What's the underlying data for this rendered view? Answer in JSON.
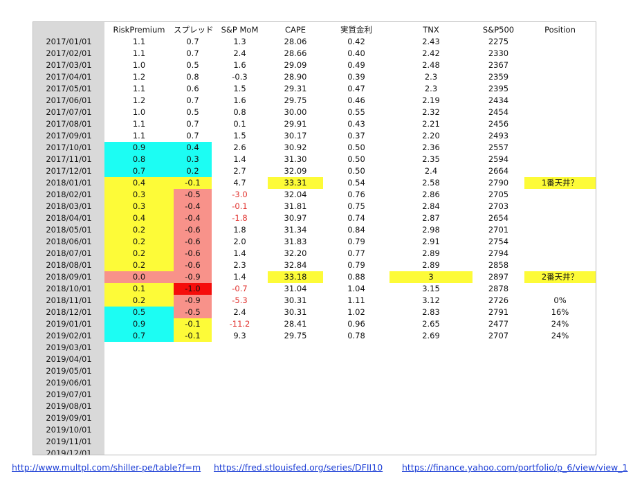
{
  "headers": [
    "RiskPremium",
    "スプレッド",
    "S&P MoM",
    "CAPE",
    "実質金利",
    "TNX",
    "S&P500",
    "Position"
  ],
  "colors": {
    "cyan": "#1cfdf3",
    "yellow": "#fdfb38",
    "salmon": "#f8928a",
    "red": "#f50d0b",
    "negative_text": "#e1312d",
    "row_header_gray": "#d9d9d9"
  },
  "rows": [
    {
      "date": "2017/01/01",
      "risk": "1.1",
      "spread": "0.7",
      "mom": "1.3",
      "cape": "28.06",
      "real": "0.42",
      "tnx": "2.43",
      "sp": "2275",
      "pos": "",
      "rc": "",
      "sc": "",
      "mc": "",
      "cc": "",
      "tc": "",
      "pc": ""
    },
    {
      "date": "2017/02/01",
      "risk": "1.1",
      "spread": "0.7",
      "mom": "2.4",
      "cape": "28.66",
      "real": "0.40",
      "tnx": "2.42",
      "sp": "2330",
      "pos": "",
      "rc": "",
      "sc": "",
      "mc": "",
      "cc": "",
      "tc": "",
      "pc": ""
    },
    {
      "date": "2017/03/01",
      "risk": "1.0",
      "spread": "0.5",
      "mom": "1.6",
      "cape": "29.09",
      "real": "0.49",
      "tnx": "2.48",
      "sp": "2367",
      "pos": "",
      "rc": "",
      "sc": "",
      "mc": "",
      "cc": "",
      "tc": "",
      "pc": ""
    },
    {
      "date": "2017/04/01",
      "risk": "1.2",
      "spread": "0.8",
      "mom": "-0.3",
      "cape": "28.90",
      "real": "0.39",
      "tnx": "2.3",
      "sp": "2359",
      "pos": "",
      "rc": "",
      "sc": "",
      "mc": "",
      "cc": "",
      "tc": "",
      "pc": ""
    },
    {
      "date": "2017/05/01",
      "risk": "1.1",
      "spread": "0.6",
      "mom": "1.5",
      "cape": "29.31",
      "real": "0.47",
      "tnx": "2.3",
      "sp": "2395",
      "pos": "",
      "rc": "",
      "sc": "",
      "mc": "",
      "cc": "",
      "tc": "",
      "pc": ""
    },
    {
      "date": "2017/06/01",
      "risk": "1.2",
      "spread": "0.7",
      "mom": "1.6",
      "cape": "29.75",
      "real": "0.46",
      "tnx": "2.19",
      "sp": "2434",
      "pos": "",
      "rc": "",
      "sc": "",
      "mc": "",
      "cc": "",
      "tc": "",
      "pc": ""
    },
    {
      "date": "2017/07/01",
      "risk": "1.0",
      "spread": "0.5",
      "mom": "0.8",
      "cape": "30.00",
      "real": "0.55",
      "tnx": "2.32",
      "sp": "2454",
      "pos": "",
      "rc": "",
      "sc": "",
      "mc": "",
      "cc": "",
      "tc": "",
      "pc": ""
    },
    {
      "date": "2017/08/01",
      "risk": "1.1",
      "spread": "0.7",
      "mom": "0.1",
      "cape": "29.91",
      "real": "0.43",
      "tnx": "2.21",
      "sp": "2456",
      "pos": "",
      "rc": "",
      "sc": "",
      "mc": "",
      "cc": "",
      "tc": "",
      "pc": ""
    },
    {
      "date": "2017/09/01",
      "risk": "1.1",
      "spread": "0.7",
      "mom": "1.5",
      "cape": "30.17",
      "real": "0.37",
      "tnx": "2.20",
      "sp": "2493",
      "pos": "",
      "rc": "",
      "sc": "",
      "mc": "",
      "cc": "",
      "tc": "",
      "pc": ""
    },
    {
      "date": "2017/10/01",
      "risk": "0.9",
      "spread": "0.4",
      "mom": "2.6",
      "cape": "30.92",
      "real": "0.50",
      "tnx": "2.36",
      "sp": "2557",
      "pos": "",
      "rc": "cyan",
      "sc": "cyan",
      "mc": "",
      "cc": "",
      "tc": "",
      "pc": ""
    },
    {
      "date": "2017/11/01",
      "risk": "0.8",
      "spread": "0.3",
      "mom": "1.4",
      "cape": "31.30",
      "real": "0.50",
      "tnx": "2.35",
      "sp": "2594",
      "pos": "",
      "rc": "cyan",
      "sc": "cyan",
      "mc": "",
      "cc": "",
      "tc": "",
      "pc": ""
    },
    {
      "date": "2017/12/01",
      "risk": "0.7",
      "spread": "0.2",
      "mom": "2.7",
      "cape": "32.09",
      "real": "0.50",
      "tnx": "2.4",
      "sp": "2664",
      "pos": "",
      "rc": "cyan",
      "sc": "cyan",
      "mc": "",
      "cc": "",
      "tc": "",
      "pc": ""
    },
    {
      "date": "2018/01/01",
      "risk": "0.4",
      "spread": "-0.1",
      "mom": "4.7",
      "cape": "33.31",
      "real": "0.54",
      "tnx": "2.58",
      "sp": "2790",
      "pos": "1番天井？",
      "rc": "yellow",
      "sc": "yellow",
      "mc": "",
      "cc": "yellow",
      "tc": "",
      "pc": "yellow"
    },
    {
      "date": "2018/02/01",
      "risk": "0.3",
      "spread": "-0.5",
      "mom": "-3.0",
      "cape": "32.04",
      "real": "0.76",
      "tnx": "2.86",
      "sp": "2705",
      "pos": "",
      "rc": "yellow",
      "sc": "salmon",
      "mc": "neg",
      "cc": "",
      "tc": "",
      "pc": ""
    },
    {
      "date": "2018/03/01",
      "risk": "0.3",
      "spread": "-0.4",
      "mom": "-0.1",
      "cape": "31.81",
      "real": "0.75",
      "tnx": "2.84",
      "sp": "2703",
      "pos": "",
      "rc": "yellow",
      "sc": "salmon",
      "mc": "neg",
      "cc": "",
      "tc": "",
      "pc": ""
    },
    {
      "date": "2018/04/01",
      "risk": "0.4",
      "spread": "-0.4",
      "mom": "-1.8",
      "cape": "30.97",
      "real": "0.74",
      "tnx": "2.87",
      "sp": "2654",
      "pos": "",
      "rc": "yellow",
      "sc": "salmon",
      "mc": "neg",
      "cc": "",
      "tc": "",
      "pc": ""
    },
    {
      "date": "2018/05/01",
      "risk": "0.2",
      "spread": "-0.6",
      "mom": "1.8",
      "cape": "31.34",
      "real": "0.84",
      "tnx": "2.98",
      "sp": "2701",
      "pos": "",
      "rc": "yellow",
      "sc": "salmon",
      "mc": "",
      "cc": "",
      "tc": "",
      "pc": ""
    },
    {
      "date": "2018/06/01",
      "risk": "0.2",
      "spread": "-0.6",
      "mom": "2.0",
      "cape": "31.83",
      "real": "0.79",
      "tnx": "2.91",
      "sp": "2754",
      "pos": "",
      "rc": "yellow",
      "sc": "salmon",
      "mc": "",
      "cc": "",
      "tc": "",
      "pc": ""
    },
    {
      "date": "2018/07/01",
      "risk": "0.2",
      "spread": "-0.6",
      "mom": "1.4",
      "cape": "32.20",
      "real": "0.77",
      "tnx": "2.89",
      "sp": "2794",
      "pos": "",
      "rc": "yellow",
      "sc": "salmon",
      "mc": "",
      "cc": "",
      "tc": "",
      "pc": ""
    },
    {
      "date": "2018/08/01",
      "risk": "0.2",
      "spread": "-0.6",
      "mom": "2.3",
      "cape": "32.84",
      "real": "0.79",
      "tnx": "2.89",
      "sp": "2858",
      "pos": "",
      "rc": "yellow",
      "sc": "salmon",
      "mc": "",
      "cc": "",
      "tc": "",
      "pc": ""
    },
    {
      "date": "2018/09/01",
      "risk": "0.0",
      "spread": "-0.9",
      "mom": "1.4",
      "cape": "33.18",
      "real": "0.88",
      "tnx": "3",
      "sp": "2897",
      "pos": "2番天井？",
      "rc": "salmon",
      "sc": "salmon",
      "mc": "",
      "cc": "yellow",
      "tc": "yellow",
      "pc": "yellow"
    },
    {
      "date": "2018/10/01",
      "risk": "0.1",
      "spread": "-1.0",
      "mom": "-0.7",
      "cape": "31.04",
      "real": "1.04",
      "tnx": "3.15",
      "sp": "2878",
      "pos": "",
      "rc": "yellow",
      "sc": "red",
      "mc": "neg",
      "cc": "",
      "tc": "",
      "pc": ""
    },
    {
      "date": "2018/11/01",
      "risk": "0.2",
      "spread": "-0.9",
      "mom": "-5.3",
      "cape": "30.31",
      "real": "1.11",
      "tnx": "3.12",
      "sp": "2726",
      "pos": "0%",
      "rc": "yellow",
      "sc": "salmon",
      "mc": "neg",
      "cc": "",
      "tc": "",
      "pc": ""
    },
    {
      "date": "2018/12/01",
      "risk": "0.5",
      "spread": "-0.5",
      "mom": "2.4",
      "cape": "30.31",
      "real": "1.02",
      "tnx": "2.83",
      "sp": "2791",
      "pos": "16%",
      "rc": "cyan",
      "sc": "salmon",
      "mc": "",
      "cc": "",
      "tc": "",
      "pc": ""
    },
    {
      "date": "2019/01/01",
      "risk": "0.9",
      "spread": "-0.1",
      "mom": "-11.2",
      "cape": "28.41",
      "real": "0.96",
      "tnx": "2.65",
      "sp": "2477",
      "pos": "24%",
      "rc": "cyan",
      "sc": "yellow",
      "mc": "neg",
      "cc": "",
      "tc": "",
      "pc": ""
    },
    {
      "date": "2019/02/01",
      "risk": "0.7",
      "spread": "-0.1",
      "mom": "9.3",
      "cape": "29.75",
      "real": "0.78",
      "tnx": "2.69",
      "sp": "2707",
      "pos": "24%",
      "rc": "cyan",
      "sc": "yellow",
      "mc": "",
      "cc": "",
      "tc": "",
      "pc": ""
    },
    {
      "date": "2019/03/01",
      "risk": "",
      "spread": "",
      "mom": "",
      "cape": "",
      "real": "",
      "tnx": "",
      "sp": "",
      "pos": "",
      "rc": "",
      "sc": "",
      "mc": "",
      "cc": "",
      "tc": "",
      "pc": ""
    },
    {
      "date": "2019/04/01",
      "risk": "",
      "spread": "",
      "mom": "",
      "cape": "",
      "real": "",
      "tnx": "",
      "sp": "",
      "pos": "",
      "rc": "",
      "sc": "",
      "mc": "",
      "cc": "",
      "tc": "",
      "pc": ""
    },
    {
      "date": "2019/05/01",
      "risk": "",
      "spread": "",
      "mom": "",
      "cape": "",
      "real": "",
      "tnx": "",
      "sp": "",
      "pos": "",
      "rc": "",
      "sc": "",
      "mc": "",
      "cc": "",
      "tc": "",
      "pc": ""
    },
    {
      "date": "2019/06/01",
      "risk": "",
      "spread": "",
      "mom": "",
      "cape": "",
      "real": "",
      "tnx": "",
      "sp": "",
      "pos": "",
      "rc": "",
      "sc": "",
      "mc": "",
      "cc": "",
      "tc": "",
      "pc": ""
    },
    {
      "date": "2019/07/01",
      "risk": "",
      "spread": "",
      "mom": "",
      "cape": "",
      "real": "",
      "tnx": "",
      "sp": "",
      "pos": "",
      "rc": "",
      "sc": "",
      "mc": "",
      "cc": "",
      "tc": "",
      "pc": ""
    },
    {
      "date": "2019/08/01",
      "risk": "",
      "spread": "",
      "mom": "",
      "cape": "",
      "real": "",
      "tnx": "",
      "sp": "",
      "pos": "",
      "rc": "",
      "sc": "",
      "mc": "",
      "cc": "",
      "tc": "",
      "pc": ""
    },
    {
      "date": "2019/09/01",
      "risk": "",
      "spread": "",
      "mom": "",
      "cape": "",
      "real": "",
      "tnx": "",
      "sp": "",
      "pos": "",
      "rc": "",
      "sc": "",
      "mc": "",
      "cc": "",
      "tc": "",
      "pc": ""
    },
    {
      "date": "2019/10/01",
      "risk": "",
      "spread": "",
      "mom": "",
      "cape": "",
      "real": "",
      "tnx": "",
      "sp": "",
      "pos": "",
      "rc": "",
      "sc": "",
      "mc": "",
      "cc": "",
      "tc": "",
      "pc": ""
    },
    {
      "date": "2019/11/01",
      "risk": "",
      "spread": "",
      "mom": "",
      "cape": "",
      "real": "",
      "tnx": "",
      "sp": "",
      "pos": "",
      "rc": "",
      "sc": "",
      "mc": "",
      "cc": "",
      "tc": "",
      "pc": ""
    },
    {
      "date": "2019/12/01",
      "risk": "",
      "spread": "",
      "mom": "",
      "cape": "",
      "real": "",
      "tnx": "",
      "sp": "",
      "pos": "",
      "rc": "",
      "sc": "",
      "mc": "",
      "cc": "",
      "tc": "",
      "pc": ""
    }
  ],
  "links": [
    "http://www.multpl.com/shiller-pe/table?f=m",
    "https://fred.stlouisfed.org/series/DFII10",
    "https://finance.yahoo.com/portfolio/p_6/view/view_1"
  ]
}
